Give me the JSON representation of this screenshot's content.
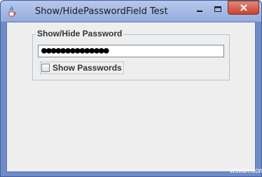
{
  "window": {
    "title": "Show/HidePasswordField Test",
    "icons": {
      "app": "java-cup-icon",
      "minimize": "minimize-icon",
      "maximize": "maximize-icon",
      "close": "close-icon"
    },
    "colors": {
      "frame": "#6f8bc6",
      "close_button": "#c8432f",
      "client_background": "#eeeeee"
    }
  },
  "password_group": {
    "title": "Show/Hide Password",
    "password_value": "●●●●●●●●●●●●●●",
    "show_passwords_label": "Show Passwords",
    "show_passwords_checked": false
  },
  "watermark": "wsxdn.com"
}
